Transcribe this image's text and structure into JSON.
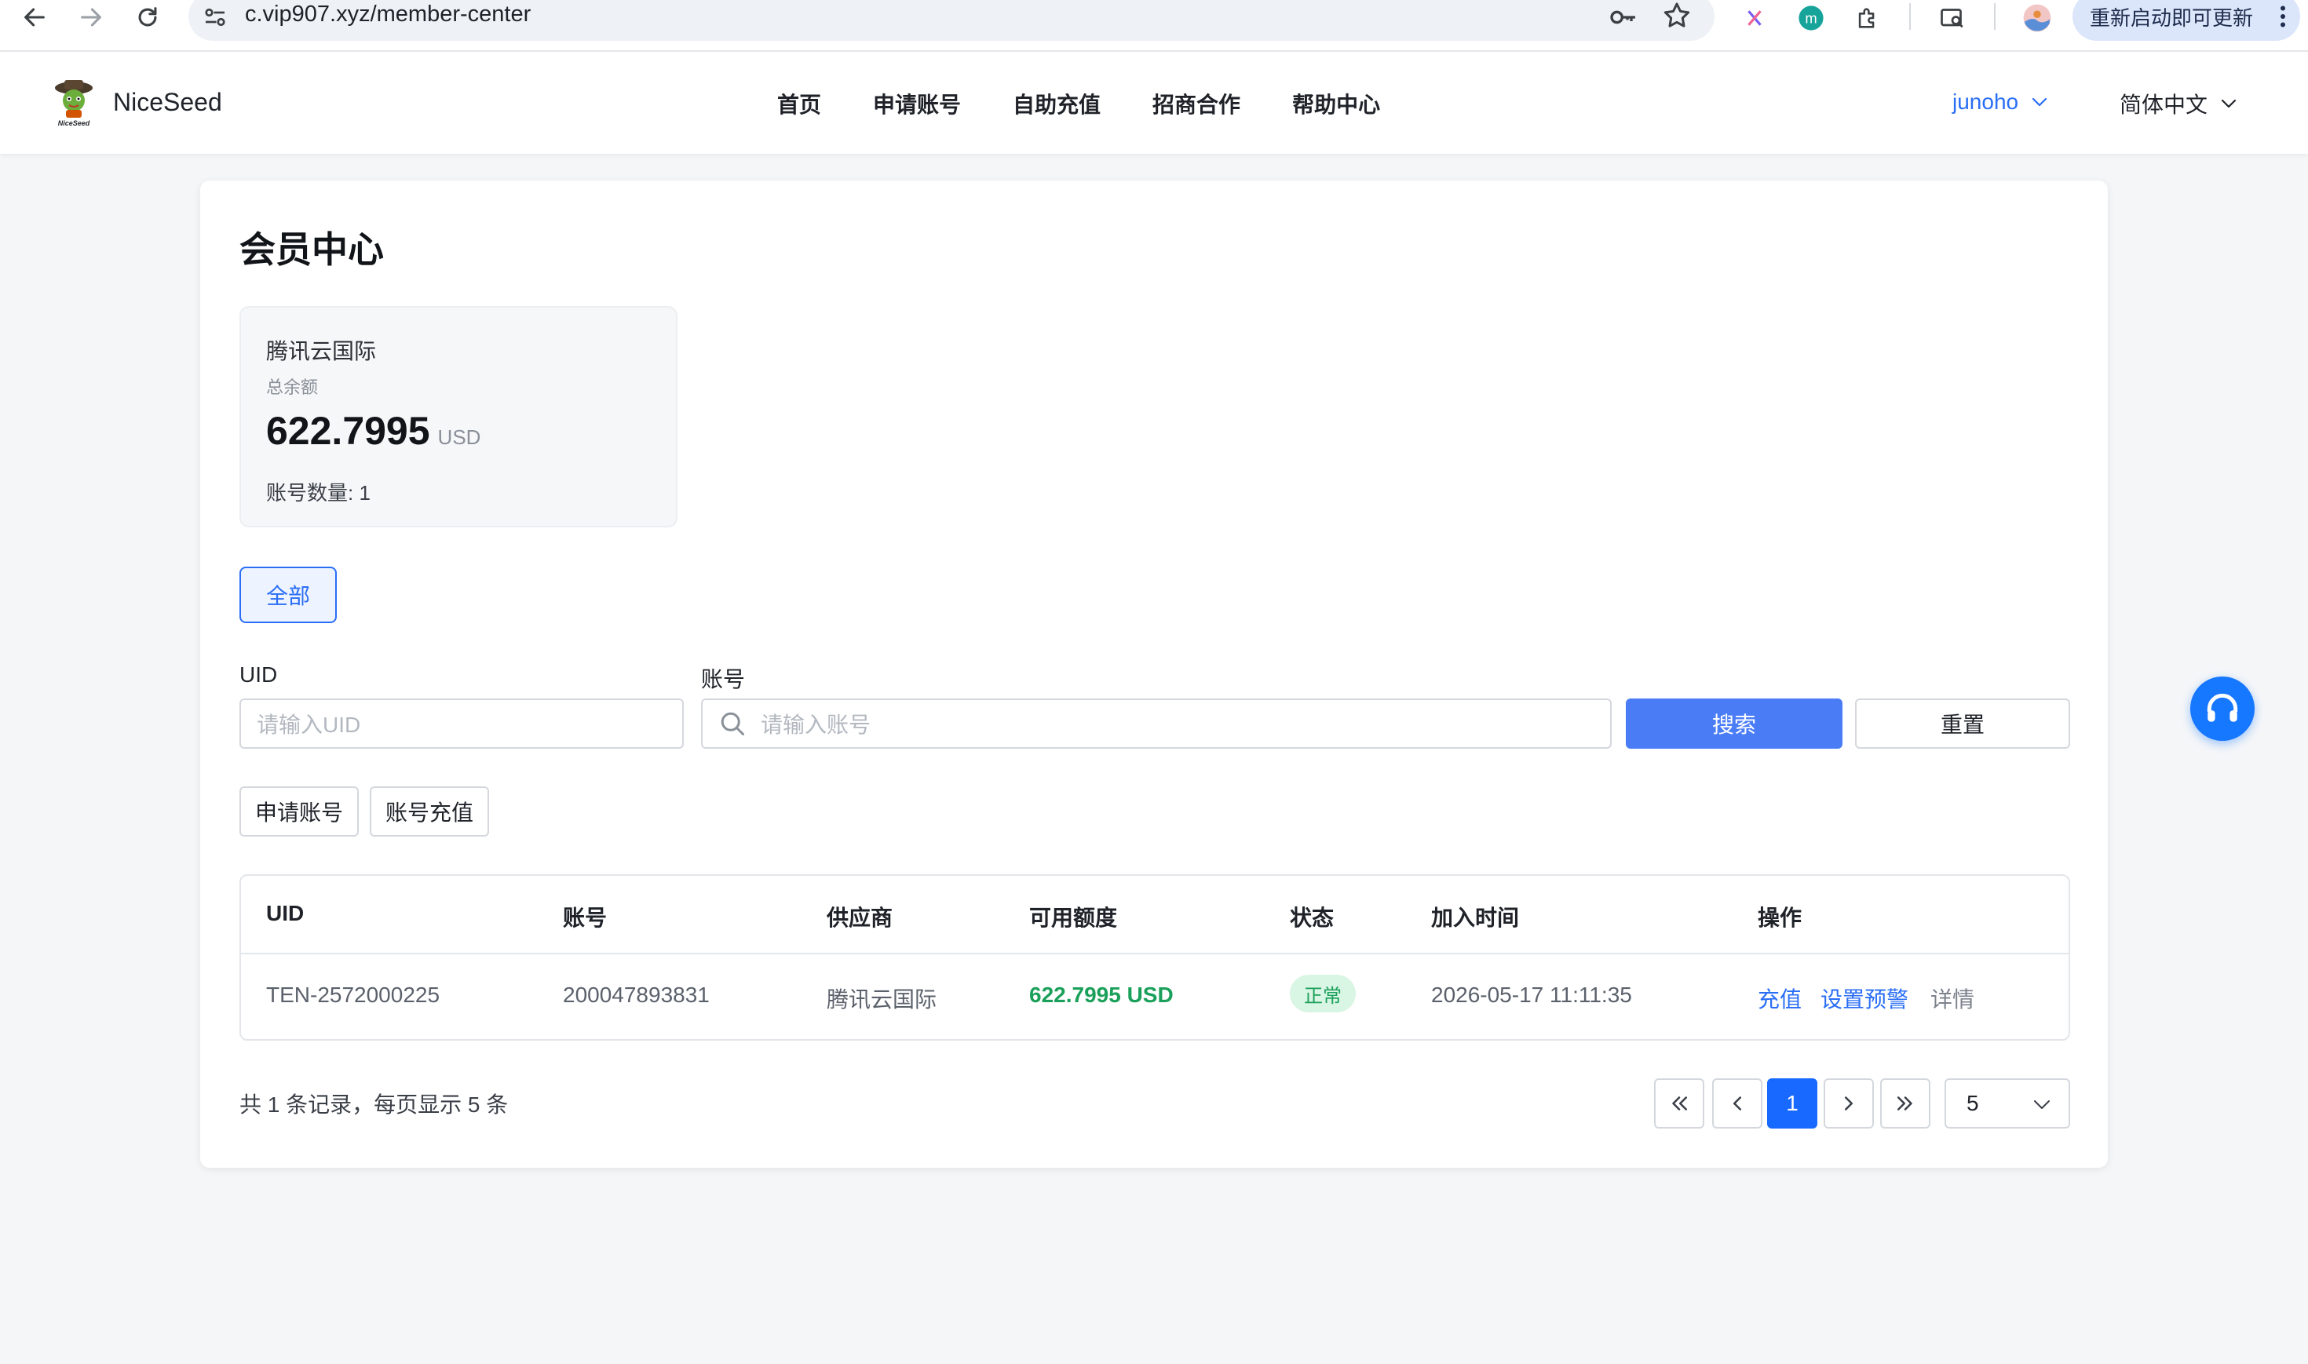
{
  "browser": {
    "url": "c.vip907.xyz/member-center",
    "update_label": "重新启动即可更新"
  },
  "header": {
    "brand_name": "NiceSeed",
    "nav": [
      "首页",
      "申请账号",
      "自助充值",
      "招商合作",
      "帮助中心"
    ],
    "username": "junoho",
    "language": "简体中文"
  },
  "page": {
    "title": "会员中心",
    "summary": {
      "provider": "腾讯云国际",
      "balance_label": "总余额",
      "balance_value": "622.7995",
      "currency": "USD",
      "account_count": "账号数量: 1"
    },
    "filter_all": "全部",
    "search": {
      "uid_label": "UID",
      "uid_placeholder": "请输入UID",
      "account_label": "账号",
      "account_placeholder": "请输入账号",
      "search_button": "搜索",
      "reset_button": "重置"
    },
    "actions": {
      "apply_account": "申请账号",
      "account_recharge": "账号充值"
    },
    "table": {
      "columns": [
        "UID",
        "账号",
        "供应商",
        "可用额度",
        "状态",
        "加入时间",
        "操作"
      ],
      "rows": [
        {
          "uid": "TEN-2572000225",
          "account": "200047893831",
          "provider": "腾讯云国际",
          "available": "622.7995 USD",
          "status": "正常",
          "joined": "2026-05-17 11:11:35",
          "op_recharge": "充值",
          "op_alert": "设置预警",
          "op_detail": "详情"
        }
      ]
    },
    "pagination": {
      "summary": "共 1 条记录，每页显示 5 条",
      "current_page": "1",
      "page_size": "5"
    }
  },
  "colors": {
    "accent": "#2a6ef5",
    "primary_button": "#4a7cf6",
    "success": "#1aa05a",
    "page_bg": "#f5f6f8"
  },
  "icons": {
    "back": "arrow-left-icon",
    "forward": "arrow-right-icon",
    "reload": "reload-icon",
    "support": "headset-icon"
  }
}
